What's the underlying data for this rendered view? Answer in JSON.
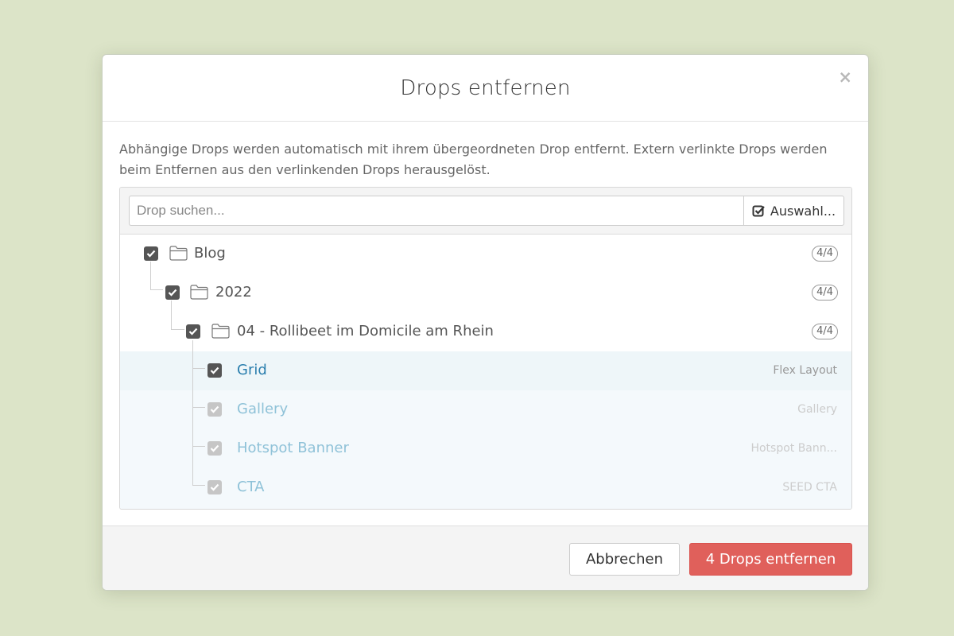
{
  "dialog": {
    "title": "Drops entfernen",
    "close_symbol": "×",
    "description": "Abhängige Drops werden automatisch mit ihrem übergeordneten Drop entfernt. Extern verlinkte Drops werden beim Entfernen aus den verlinkenden Drops herausgelöst."
  },
  "search": {
    "placeholder": "Drop suchen...",
    "select_label": "Auswahl...",
    "select_icon": "check-square-icon"
  },
  "tree": [
    {
      "label": "Blog",
      "badge": "4/4",
      "icon": "folder-icon",
      "checked": true,
      "level": 0
    },
    {
      "label": "2022",
      "badge": "4/4",
      "icon": "folder-icon",
      "checked": true,
      "level": 1
    },
    {
      "label": "04 - Rollibeet im Domicile am Rhein",
      "badge": "4/4",
      "icon": "folder-icon",
      "checked": true,
      "level": 2
    },
    {
      "label": "Grid",
      "type": "Flex Layout",
      "checked": true,
      "disabled": false,
      "level": 3
    },
    {
      "label": "Gallery",
      "type": "Gallery",
      "checked": true,
      "disabled": true,
      "level": 3
    },
    {
      "label": "Hotspot Banner",
      "type": "Hotspot Bann...",
      "checked": true,
      "disabled": true,
      "level": 3
    },
    {
      "label": "CTA",
      "type": "SEED CTA",
      "checked": true,
      "disabled": true,
      "level": 3
    }
  ],
  "footer": {
    "cancel_label": "Abbrechen",
    "remove_label": "4 Drops entfernen"
  },
  "colors": {
    "background": "#dce4c8",
    "danger": "#e0605b",
    "link": "#2b7fae",
    "highlight_row": "#eef6f9"
  }
}
